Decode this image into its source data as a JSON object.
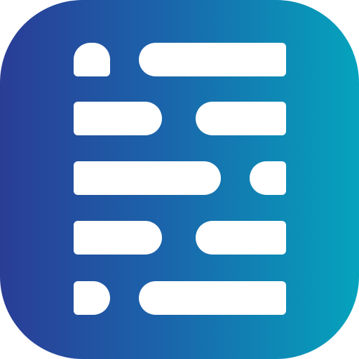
{
  "icon": {
    "name": "document-lines-app-icon",
    "gradient_start": "#2a3d96",
    "gradient_mid": "#1b64ab",
    "gradient_end": "#05a3bd",
    "glyph_color": "#ffffff",
    "rows": [
      {
        "left": "short",
        "right": "long"
      },
      {
        "left": "medium",
        "right": "medium"
      },
      {
        "left": "long",
        "right": "short"
      },
      {
        "left": "medium",
        "right": "medium"
      },
      {
        "left": "short",
        "right": "long"
      }
    ]
  }
}
